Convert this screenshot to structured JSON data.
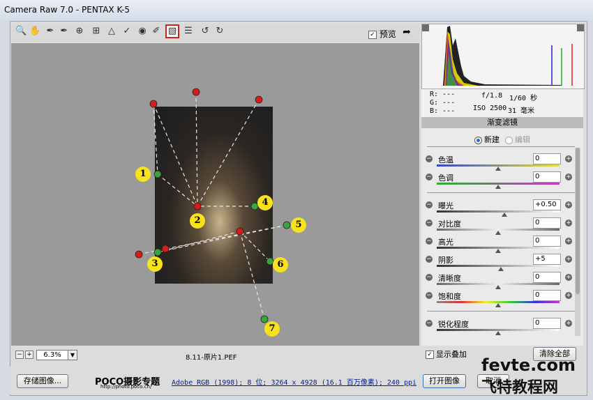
{
  "window": {
    "title": "Camera Raw 7.0 -  PENTAX K-5"
  },
  "toolbar": {
    "icons": [
      "zoom-icon",
      "hand-icon",
      "white-balance-icon",
      "color-sampler-icon",
      "target-adjust-icon",
      "crop-icon",
      "straighten-icon",
      "spot-removal-icon",
      "red-eye-icon",
      "adjustment-brush-icon",
      "graduated-filter-icon",
      "preferences-icon",
      "rotate-ccw-icon",
      "rotate-cw-icon"
    ],
    "preview_label": "预览",
    "preview_checked": true
  },
  "markers": [
    "1",
    "2",
    "3",
    "4",
    "5",
    "6",
    "7"
  ],
  "status": {
    "zoom": "6.3%",
    "filename": "8.11-原片1.PEF"
  },
  "readout": {
    "r": "R:  ---",
    "g": "G:  ---",
    "b": "B:  ---",
    "aperture": "f/1.8",
    "shutter": "1/60 秒",
    "iso": "ISO 2500",
    "focal": "31 毫米"
  },
  "panel": {
    "title": "渐变滤镜",
    "mode_new": "新建",
    "mode_edit": "编辑",
    "sliders": [
      {
        "label": "色温",
        "value": "0",
        "pos": 0.5
      },
      {
        "label": "色调",
        "value": "0",
        "pos": 0.5
      },
      {
        "label": "曝光",
        "value": "+0.50",
        "pos": 0.55
      },
      {
        "label": "对比度",
        "value": "0",
        "pos": 0.5
      },
      {
        "label": "高光",
        "value": "0",
        "pos": 0.5
      },
      {
        "label": "阴影",
        "value": "+5",
        "pos": 0.52
      },
      {
        "label": "清晰度",
        "value": "0",
        "pos": 0.5
      },
      {
        "label": "饱和度",
        "value": "0",
        "pos": 0.5
      },
      {
        "label": "锐化程度",
        "value": "0",
        "pos": 0.5
      }
    ],
    "show_overlay": "显示叠加",
    "clear_all": "清除全部"
  },
  "bottom": {
    "save": "存储图像...",
    "logo": "POCO摄影专题",
    "logo_url": "http://photo.poco.cn/",
    "workflow": "Adobe RGB (1998); 8 位; 3264 x 4928 (16.1 百万像素); 240 ppi",
    "open": "打开图像",
    "cancel": "取消"
  },
  "watermark": {
    "line1": "fevte.com",
    "line2": "飞特教程网"
  },
  "colors": {
    "marker_red": "#d81a1a",
    "marker_green": "#3aa53a",
    "badge": "#f7e21b"
  }
}
